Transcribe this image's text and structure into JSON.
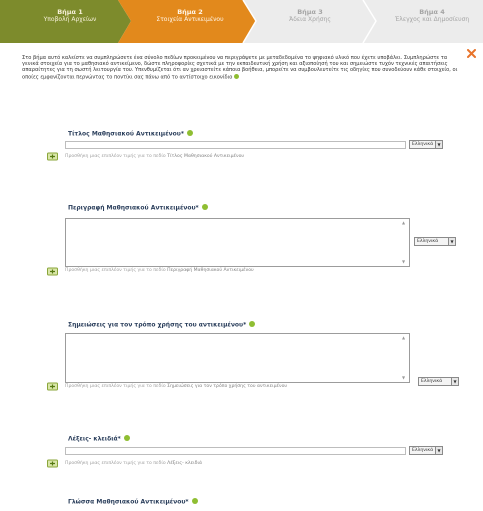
{
  "wizard": {
    "steps": [
      {
        "num": "Βήμα 1",
        "label": "Υποβολή Αρχείων"
      },
      {
        "num": "Βήμα 2",
        "label": "Στοιχεία Αντικειμένου"
      },
      {
        "num": "Βήμα 3",
        "label": "Άδεια Χρήσης"
      },
      {
        "num": "Βήμα 4",
        "label": "Έλεγχος και Δημοσίευση"
      }
    ],
    "colors": {
      "done": "#7d8b2c",
      "active": "#e2891c",
      "pending": "#ececec"
    }
  },
  "intro": {
    "text": "Στο βήμα αυτό καλείστε να συμπληρώσετε ένα σύνολο πεδίων προκειμένου να περιγράψετε με μεταδεδομένα το ψηφιακό υλικό που έχετε υποβάλει. Συμπληρώστε τα γενικά στοιχεία για το μαθησιακό αντικείμενο, δώστε πληροφορίες σχετικά με την εκπαιδευτική χρήση και αξιοποίησή του και σημειώστε τυχόν τεχνικές απαιτήσεις απαραίτητες για τη σωστή λειτουργία του. Υπενθυμίζεται ότι αν χρειαστείτε κάποια βοήθεια, μπορείτε να συμβουλευτείτε τις οδηγίες που συνοδεύουν κάθε στοιχείο, οι οποίες εμφανίζονται περνώντας το ποντίκι σας πάνω από το αντίστοιχο εικονίδιο"
  },
  "fields": {
    "title": {
      "label": "Τίτλος Μαθησιακού Αντικειμένου*",
      "value": "",
      "language": "Ελληνικά",
      "hint_prefix": "Προσθήκη μιας επιπλέον τιμής για το πεδίο",
      "hint_field": "Τίτλος Μαθησιακού Αντικειμένου"
    },
    "description": {
      "label": "Περιγραφή Μαθησιακού Αντικειμένου*",
      "value": "",
      "language": "Ελληνικά",
      "hint_prefix": "Προσθήκη μιας επιπλέον τιμής για το πεδίο",
      "hint_field": "Περιγραφή Μαθησιακού Αντικειμένου"
    },
    "usage_notes": {
      "label": "Σημειώσεις για τον τρόπο χρήσης του αντικειμένου*",
      "value": "",
      "language": "Ελληνικά",
      "hint_prefix": "Προσθήκη μιας επιπλέον τιμής για το πεδίο",
      "hint_field": "Σημειώσεις για τον τρόπο χρήσης του αντικειμένου"
    },
    "keywords": {
      "label": "Λέξεις- κλειδιά*",
      "value": "",
      "language": "Ελληνικά",
      "hint_prefix": "Προσθήκη μιας επιπλέον τιμής για το πεδίο",
      "hint_field": "Λέξεις- κλειδιά"
    },
    "object_language": {
      "label": "Γλώσσα Μαθησιακού Αντικειμένου*"
    }
  },
  "icons": {
    "help": "help-icon",
    "add": "add-value-icon",
    "close": "close-icon"
  }
}
